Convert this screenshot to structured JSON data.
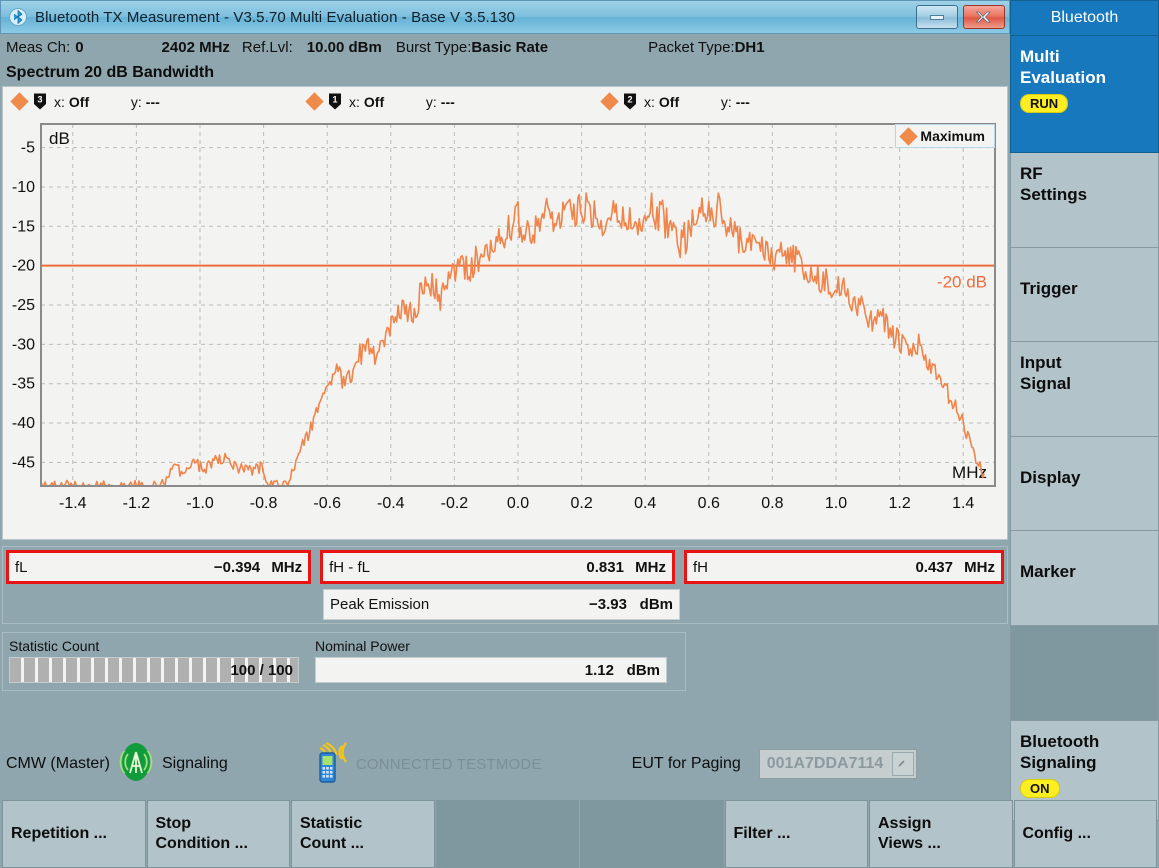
{
  "window": {
    "title": "Bluetooth TX Measurement  - V3.5.70 Multi Evaluation - Base V 3.5.130",
    "minimize_label": "minimize",
    "close_label": "close"
  },
  "info": {
    "meas_ch_label": "Meas Ch:",
    "meas_ch_value": "0",
    "frequency": "2402 MHz",
    "ref_lvl_label": "Ref.Lvl:",
    "ref_lvl_value": "10.00 dBm",
    "burst_type_label": "Burst Type:",
    "burst_type_value": "Basic Rate",
    "packet_type_label": "Packet Type:",
    "packet_type_value": "DH1"
  },
  "subtitle": "Spectrum 20 dB Bandwidth",
  "markers": [
    {
      "icon": "marker-flag-3",
      "number": "3",
      "x_label": "x:",
      "x_value": "Off",
      "y_label": "y:",
      "y_value": "---"
    },
    {
      "icon": "marker-flag-1",
      "number": "1",
      "x_label": "x:",
      "x_value": "Off",
      "y_label": "y:",
      "y_value": "---"
    },
    {
      "icon": "marker-flag-2",
      "number": "2",
      "x_label": "x:",
      "x_value": "Off",
      "y_label": "y:",
      "y_value": "---"
    }
  ],
  "chart_data": {
    "type": "line",
    "title": "Spectrum 20 dB Bandwidth",
    "xlabel": "MHz",
    "ylabel": "dB",
    "xlim": [
      -1.5,
      1.5
    ],
    "ylim": [
      -48,
      -2
    ],
    "grid": true,
    "legend": {
      "position": "top-right",
      "entries": [
        "Maximum"
      ]
    },
    "series_name": "Maximum",
    "series_color": "#f0844a",
    "threshold": {
      "value": -20,
      "label": "-20 dB",
      "color": "#ef6c3a"
    },
    "xticks": [
      -1.4,
      -1.2,
      -1.0,
      -0.8,
      -0.6,
      -0.4,
      -0.2,
      0.0,
      0.2,
      0.4,
      0.6,
      0.8,
      1.0,
      1.2,
      1.4
    ],
    "yticks": [
      -5,
      -10,
      -15,
      -20,
      -25,
      -30,
      -35,
      -40,
      -45
    ],
    "x": [
      -1.5,
      -1.47,
      -1.44,
      -1.41,
      -1.38,
      -1.35,
      -1.32,
      -1.29,
      -1.26,
      -1.23,
      -1.2,
      -1.17,
      -1.14,
      -1.11,
      -1.08,
      -1.05,
      -1.02,
      -0.99,
      -0.96,
      -0.93,
      -0.9,
      -0.87,
      -0.84,
      -0.81,
      -0.78,
      -0.75,
      -0.72,
      -0.69,
      -0.66,
      -0.63,
      -0.6,
      -0.57,
      -0.54,
      -0.51,
      -0.48,
      -0.45,
      -0.42,
      -0.39,
      -0.36,
      -0.33,
      -0.3,
      -0.27,
      -0.24,
      -0.21,
      -0.18,
      -0.15,
      -0.12,
      -0.09,
      -0.06,
      -0.03,
      0.0,
      0.03,
      0.06,
      0.09,
      0.12,
      0.15,
      0.18,
      0.21,
      0.24,
      0.27,
      0.3,
      0.33,
      0.36,
      0.39,
      0.42,
      0.45,
      0.48,
      0.51,
      0.54,
      0.57,
      0.6,
      0.63,
      0.66,
      0.69,
      0.72,
      0.75,
      0.78,
      0.81,
      0.84,
      0.87,
      0.9,
      0.93,
      0.96,
      0.99,
      1.02,
      1.05,
      1.08,
      1.11,
      1.14,
      1.17,
      1.2,
      1.23,
      1.26,
      1.29,
      1.32,
      1.35,
      1.38,
      1.41,
      1.44,
      1.47,
      1.5
    ],
    "y": [
      -48.0,
      -48.0,
      -48.0,
      -48.0,
      -48.0,
      -48.0,
      -48.0,
      -48.0,
      -48.0,
      -48.0,
      -48.0,
      -48.0,
      -48.0,
      -47.6,
      -45.8,
      -46.5,
      -44.7,
      -45.9,
      -45.2,
      -44.4,
      -45.3,
      -45.8,
      -46.2,
      -45.5,
      -48.0,
      -48.0,
      -47.4,
      -44.4,
      -41.2,
      -38.6,
      -35.6,
      -33.5,
      -34.9,
      -32.2,
      -30.3,
      -31.5,
      -28.8,
      -26.5,
      -24.9,
      -26.2,
      -23.1,
      -22.6,
      -24.2,
      -21.3,
      -19.8,
      -20.6,
      -18.6,
      -17.3,
      -16.6,
      -15.0,
      -14.1,
      -15.8,
      -14.6,
      -13.4,
      -14.2,
      -12.8,
      -13.9,
      -12.4,
      -13.1,
      -14.3,
      -12.6,
      -13.8,
      -15.2,
      -14.0,
      -12.9,
      -13.6,
      -15.5,
      -17.2,
      -15.8,
      -12.8,
      -13.5,
      -12.7,
      -14.8,
      -17.0,
      -16.2,
      -18.5,
      -17.4,
      -19.4,
      -18.2,
      -19.1,
      -20.7,
      -22.4,
      -21.3,
      -23.9,
      -22.1,
      -25.6,
      -24.3,
      -27.2,
      -25.4,
      -28.6,
      -29.8,
      -31.2,
      -30.0,
      -32.5,
      -34.4,
      -36.2,
      -38.5,
      -41.0,
      -44.5,
      -47.0
    ]
  },
  "results": {
    "fl": {
      "label": "fL",
      "value": "−0.394",
      "unit": "MHz"
    },
    "fh_fl": {
      "label": "fH - fL",
      "value": "0.831",
      "unit": "MHz"
    },
    "fh": {
      "label": "fH",
      "value": "0.437",
      "unit": "MHz"
    },
    "peak_emission": {
      "label": "Peak Emission",
      "value": "−3.93",
      "unit": "dBm"
    }
  },
  "statistics": {
    "statistic_count_label": "Statistic Count",
    "statistic_count_value": "100 / 100",
    "statistic_count_percent": 100,
    "nominal_power_label": "Nominal Power",
    "nominal_power_value": "1.12",
    "nominal_power_unit": "dBm"
  },
  "status": {
    "device": "CMW (Master)",
    "signaling": "Signaling",
    "connection_state": "CONNECTED TESTMODE",
    "eut_label": "EUT for Paging",
    "eut_address": "001A7DDA7114"
  },
  "sidebar": {
    "header": "Bluetooth",
    "items": [
      {
        "label": "Multi\nEvaluation",
        "badge": "RUN",
        "active": true
      },
      {
        "label": "RF\nSettings",
        "badge": null,
        "active": false
      },
      {
        "label": "Trigger",
        "badge": null,
        "active": false
      },
      {
        "label": "Input\nSignal",
        "badge": null,
        "active": false
      },
      {
        "label": "Display",
        "badge": null,
        "active": false
      },
      {
        "label": "Marker",
        "badge": null,
        "active": false
      },
      {
        "label": "",
        "badge": null,
        "active": false,
        "empty": true
      },
      {
        "label": "Bluetooth\nSignaling",
        "badge": "ON",
        "active": false
      }
    ]
  },
  "toolbar": [
    {
      "label": "Repetition ...",
      "empty": false
    },
    {
      "label": "Stop\nCondition ...",
      "empty": false
    },
    {
      "label": "Statistic\nCount ...",
      "empty": false
    },
    {
      "label": "",
      "empty": true
    },
    {
      "label": "",
      "empty": true
    },
    {
      "label": "Filter ...",
      "empty": false
    },
    {
      "label": "Assign\nViews ...",
      "empty": false
    },
    {
      "label": "Config ...",
      "empty": false
    }
  ]
}
